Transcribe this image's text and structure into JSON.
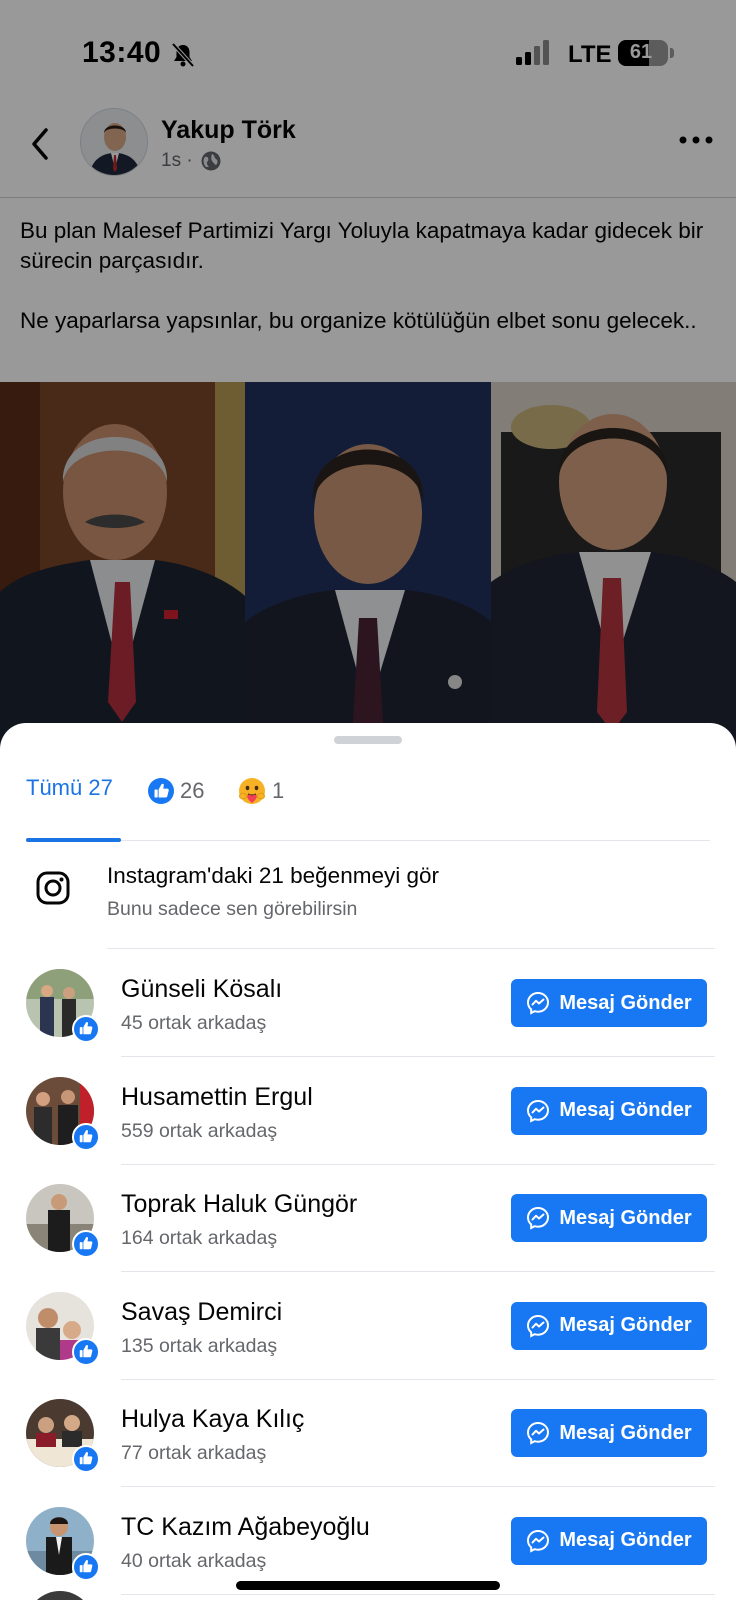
{
  "status_bar": {
    "time": "13:40",
    "network": "LTE",
    "battery": "61",
    "battery_level": 0.61
  },
  "post": {
    "author": "Yakup Törk",
    "time": "1s",
    "paragraphs": [
      "Bu plan Malesef Partimizi Yargı Yoluyla kapatmaya kadar gidecek bir sürecin parçasıdır.",
      "Ne yaparlarsa yapsınlar, bu organize kötülüğün elbet sonu gelecek.."
    ]
  },
  "reactions": {
    "tab_all": "Tümü 27",
    "like_count": "26",
    "care_count": "1"
  },
  "instagram": {
    "title": "Instagram'daki 21 beğenmeyi gör",
    "subtitle": "Bunu sadece sen görebilirsin"
  },
  "people": [
    {
      "name": "Günseli Kösalı",
      "mutual": "45 ortak arkadaş",
      "button": "Mesaj Gönder"
    },
    {
      "name": "Husamettin Ergul",
      "mutual": "559 ortak arkadaş",
      "button": "Mesaj Gönder"
    },
    {
      "name": "Toprak Haluk Güngör",
      "mutual": "164 ortak arkadaş",
      "button": "Mesaj Gönder"
    },
    {
      "name": "Savaş Demirci",
      "mutual": "135 ortak arkadaş",
      "button": "Mesaj Gönder"
    },
    {
      "name": "Hulya Kaya Kılıç",
      "mutual": "77 ortak arkadaş",
      "button": "Mesaj Gönder"
    },
    {
      "name": "TC Kazım Ağabeyoğlu",
      "mutual": "40 ortak arkadaş",
      "button": "Mesaj Gönder"
    }
  ],
  "colors": {
    "accent": "#1877f2",
    "tab_active": "#1b74e4",
    "secondary_text": "#65676b"
  }
}
